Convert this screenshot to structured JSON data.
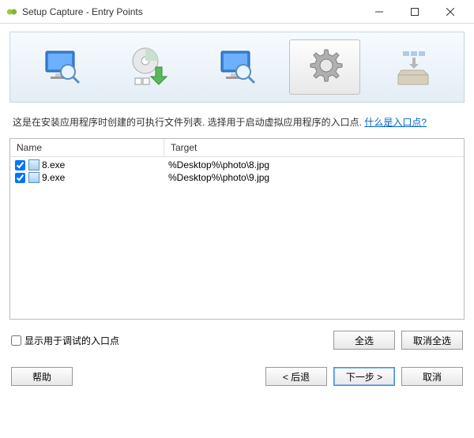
{
  "window": {
    "title": "Setup Capture - Entry Points"
  },
  "description": {
    "text_prefix": "这是在安装应用程序时创建的可执行文件列表. 选择用于启动虚拟应用程序的入口点. ",
    "link_text": "什么是入口点?"
  },
  "list": {
    "columns": {
      "name": "Name",
      "target": "Target"
    },
    "rows": [
      {
        "checked": true,
        "name": "8.exe",
        "target": "%Desktop%\\photo\\8.jpg"
      },
      {
        "checked": true,
        "name": "9.exe",
        "target": "%Desktop%\\photo\\9.jpg"
      }
    ]
  },
  "options": {
    "debug_label": "显示用于调试的入口点",
    "select_all": "全选",
    "deselect_all": "取消全选"
  },
  "buttons": {
    "help": "帮助",
    "back": "< 后退",
    "next": "下一步 >",
    "cancel": "取消"
  }
}
